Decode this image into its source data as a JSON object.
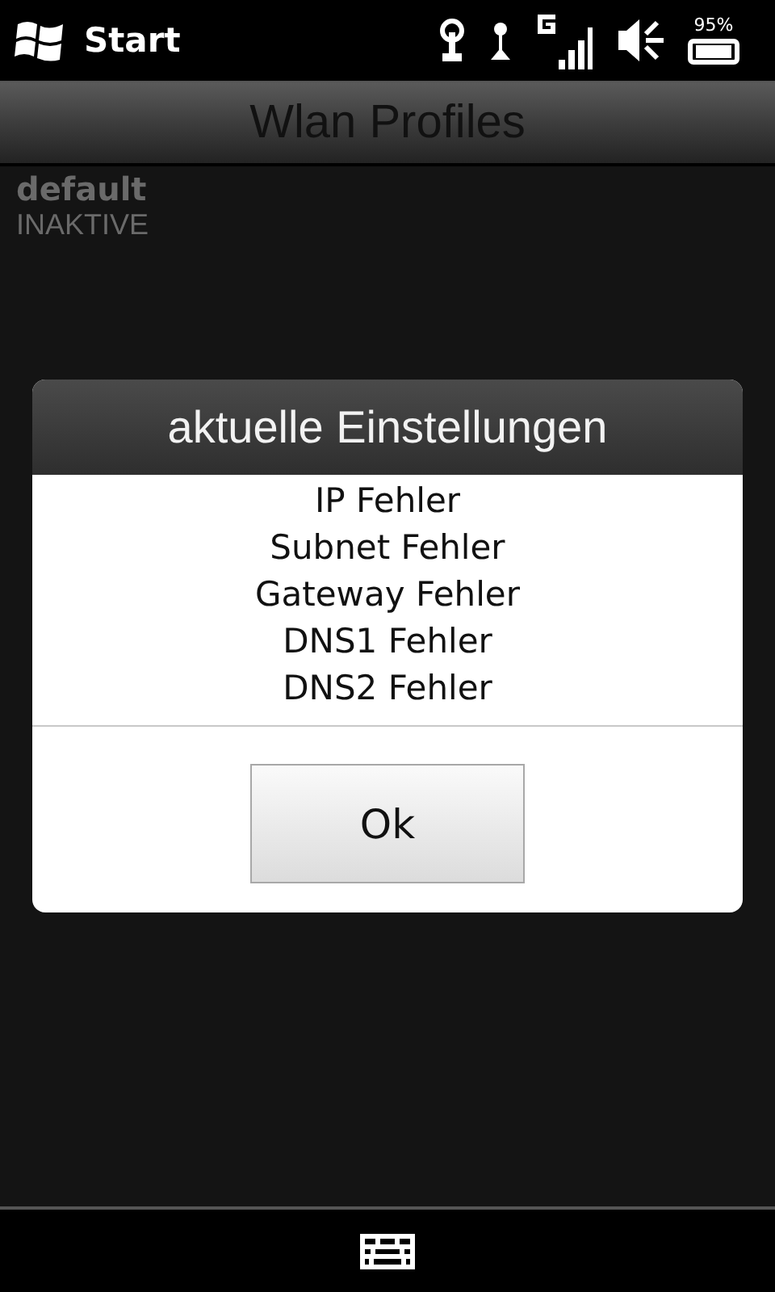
{
  "status_bar": {
    "start_label": "Start",
    "battery_percent": "95%"
  },
  "title_bar": {
    "title": "Wlan Profiles"
  },
  "profile": {
    "name": "default",
    "status": "INAKTIVE"
  },
  "dialog": {
    "title": "aktuelle Einstellungen",
    "lines": [
      "IP Fehler",
      "Subnet Fehler",
      "Gateway Fehler",
      "DNS1 Fehler",
      "DNS2 Fehler"
    ],
    "button": "Ok"
  }
}
